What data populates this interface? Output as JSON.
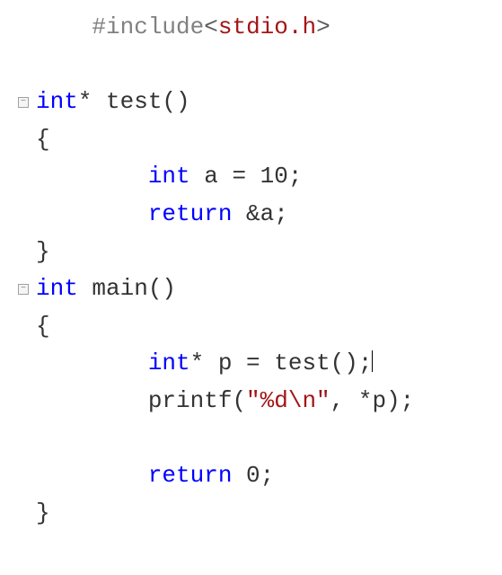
{
  "code": {
    "language": "c",
    "lines": [
      {
        "indent": 1,
        "tokens": [
          {
            "class": "include-keyword",
            "text": "#include"
          },
          {
            "class": "angle",
            "text": "<"
          },
          {
            "class": "header",
            "text": "stdio.h"
          },
          {
            "class": "angle",
            "text": ">"
          }
        ]
      },
      {
        "blank": true
      },
      {
        "fold": true,
        "indent": 0,
        "tokens": [
          {
            "class": "keyword",
            "text": "int"
          },
          {
            "class": "plain",
            "text": "* test()"
          }
        ]
      },
      {
        "indent": 0,
        "tokens": [
          {
            "class": "plain",
            "text": "{"
          }
        ]
      },
      {
        "indent": 2,
        "tokens": [
          {
            "class": "keyword",
            "text": "int"
          },
          {
            "class": "plain",
            "text": " a = 10;"
          }
        ]
      },
      {
        "indent": 2,
        "tokens": [
          {
            "class": "keyword",
            "text": "return"
          },
          {
            "class": "plain",
            "text": " &a;"
          }
        ]
      },
      {
        "indent": 0,
        "tokens": [
          {
            "class": "plain",
            "text": "}"
          }
        ]
      },
      {
        "fold": true,
        "indent": 0,
        "tokens": [
          {
            "class": "keyword",
            "text": "int"
          },
          {
            "class": "plain",
            "text": " main()"
          }
        ]
      },
      {
        "indent": 0,
        "tokens": [
          {
            "class": "plain",
            "text": "{"
          }
        ]
      },
      {
        "indent": 2,
        "tokens": [
          {
            "class": "keyword",
            "text": "int"
          },
          {
            "class": "plain",
            "text": "* p = test();"
          }
        ],
        "cursor": true
      },
      {
        "indent": 2,
        "tokens": [
          {
            "class": "plain",
            "text": "printf("
          },
          {
            "class": "string",
            "text": "\"%d\\n\""
          },
          {
            "class": "plain",
            "text": ", *p);"
          }
        ]
      },
      {
        "blank": true
      },
      {
        "indent": 2,
        "tokens": [
          {
            "class": "keyword",
            "text": "return"
          },
          {
            "class": "plain",
            "text": " 0;"
          }
        ]
      },
      {
        "indent": 0,
        "tokens": [
          {
            "class": "plain",
            "text": "}"
          }
        ]
      }
    ]
  },
  "fold_glyph": "−"
}
